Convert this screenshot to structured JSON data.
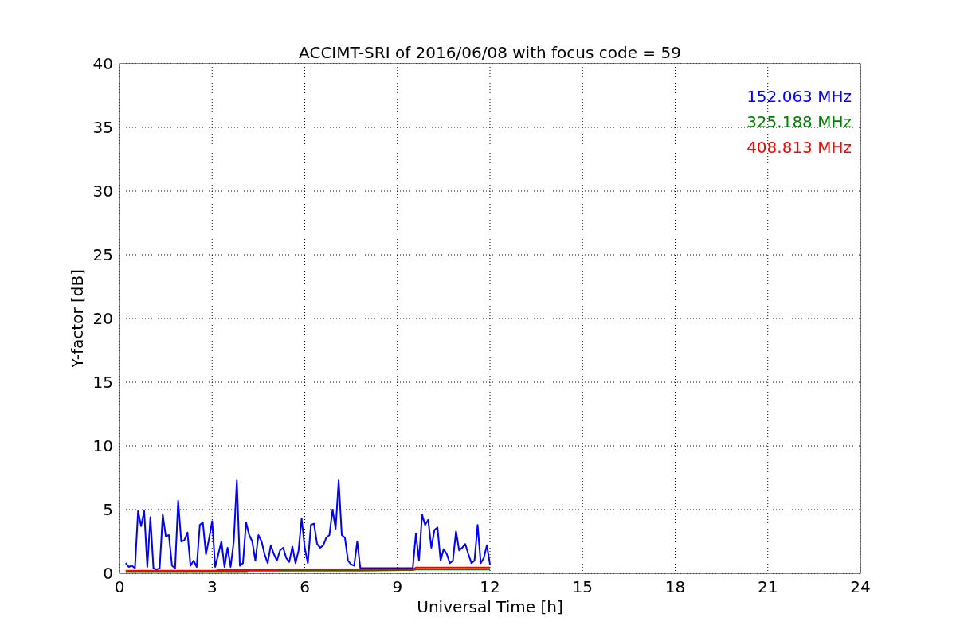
{
  "chart_data": {
    "type": "line",
    "title": "ACCIMT-SRI of 2016/06/08 with focus code = 59",
    "xlabel": "Universal Time [h]",
    "ylabel": "Y-factor [dB]",
    "x": [
      0.2,
      0.3,
      0.4,
      0.5,
      0.6,
      0.7,
      0.8,
      0.9,
      1.0,
      1.1,
      1.2,
      1.3,
      1.4,
      1.5,
      1.6,
      1.7,
      1.8,
      1.9,
      2.0,
      2.1,
      2.2,
      2.3,
      2.4,
      2.5,
      2.6,
      2.7,
      2.8,
      2.9,
      3.0,
      3.1,
      3.2,
      3.3,
      3.4,
      3.5,
      3.6,
      3.7,
      3.8,
      3.9,
      4.0,
      4.1,
      4.2,
      4.3,
      4.4,
      4.5,
      4.6,
      4.7,
      4.8,
      4.9,
      5.0,
      5.1,
      5.2,
      5.3,
      5.4,
      5.5,
      5.6,
      5.7,
      5.8,
      5.9,
      6.0,
      6.1,
      6.2,
      6.3,
      6.4,
      6.5,
      6.6,
      6.7,
      6.8,
      6.9,
      7.0,
      7.1,
      7.2,
      7.3,
      7.4,
      7.5,
      7.6,
      7.7,
      7.8,
      9.5,
      9.6,
      9.7,
      9.8,
      9.9,
      10.0,
      10.1,
      10.2,
      10.3,
      10.4,
      10.5,
      10.6,
      10.7,
      10.8,
      10.9,
      11.0,
      11.1,
      11.2,
      11.3,
      11.4,
      11.5,
      11.6,
      11.7,
      11.8,
      11.9,
      12.0
    ],
    "series": [
      {
        "name": "152.063 MHz",
        "color": "#0000ff",
        "values": [
          0.8,
          0.5,
          0.6,
          0.4,
          4.9,
          3.7,
          4.9,
          0.5,
          4.4,
          0.4,
          0.3,
          0.4,
          4.6,
          2.9,
          3.0,
          0.6,
          0.4,
          5.7,
          2.5,
          2.6,
          3.2,
          0.6,
          1.0,
          0.5,
          3.8,
          4.0,
          1.5,
          2.7,
          4.1,
          0.5,
          1.5,
          2.5,
          0.5,
          2.0,
          0.5,
          2.5,
          7.3,
          0.6,
          0.8,
          4.0,
          3.0,
          2.5,
          1.0,
          3.0,
          2.5,
          1.5,
          0.8,
          2.2,
          1.5,
          1.0,
          1.8,
          2.0,
          1.2,
          0.9,
          2.1,
          0.8,
          1.8,
          4.3,
          2.0,
          0.8,
          3.8,
          3.9,
          2.3,
          2.0,
          2.2,
          2.8,
          3.0,
          5.0,
          3.5,
          7.3,
          3.0,
          2.8,
          1.0,
          0.7,
          0.6,
          2.5,
          0.4,
          0.4,
          3.1,
          1.0,
          4.6,
          3.8,
          4.2,
          2.0,
          3.4,
          3.6,
          1.0,
          1.9,
          1.5,
          0.8,
          1.0,
          3.3,
          1.8,
          2.0,
          2.3,
          1.5,
          0.8,
          1.0,
          3.8,
          0.8,
          1.2,
          2.2,
          0.7
        ]
      },
      {
        "name": "325.188 MHz",
        "color": "#008000",
        "values": [
          0.15,
          0.15,
          0.15,
          0.15,
          0.15,
          0.15,
          0.15,
          0.15,
          0.15,
          0.15,
          0.15,
          0.15,
          0.15,
          0.15,
          0.15,
          0.15,
          0.15,
          0.15,
          0.15,
          0.15,
          0.15,
          0.15,
          0.15,
          0.15,
          0.15,
          0.15,
          0.15,
          0.15,
          0.15,
          0.15,
          0.15,
          0.15,
          0.15,
          0.15,
          0.15,
          0.15,
          0.15,
          0.15,
          0.15,
          0.15,
          0.2,
          0.2,
          0.2,
          0.2,
          0.2,
          0.2,
          0.2,
          0.2,
          0.2,
          0.2,
          0.2,
          0.2,
          0.2,
          0.2,
          0.2,
          0.2,
          0.2,
          0.2,
          0.2,
          0.2,
          0.2,
          0.2,
          0.2,
          0.2,
          0.2,
          0.2,
          0.2,
          0.2,
          0.2,
          0.2,
          0.2,
          0.2,
          0.2,
          0.2,
          0.2,
          0.2,
          0.2,
          0.25,
          0.3,
          0.3,
          0.3,
          0.3,
          0.3,
          0.3,
          0.3,
          0.3,
          0.3,
          0.3,
          0.3,
          0.3,
          0.3,
          0.3,
          0.3,
          0.3,
          0.3,
          0.3,
          0.3,
          0.3,
          0.3,
          0.3,
          0.3,
          0.3,
          0.3
        ]
      },
      {
        "name": "408.813 MHz",
        "color": "#ff0000",
        "values": [
          0.2,
          0.2,
          0.2,
          0.2,
          0.2,
          0.2,
          0.2,
          0.2,
          0.2,
          0.2,
          0.2,
          0.2,
          0.2,
          0.2,
          0.2,
          0.2,
          0.2,
          0.2,
          0.2,
          0.2,
          0.2,
          0.2,
          0.2,
          0.2,
          0.2,
          0.2,
          0.2,
          0.2,
          0.2,
          0.2,
          0.25,
          0.25,
          0.25,
          0.25,
          0.25,
          0.25,
          0.25,
          0.25,
          0.25,
          0.25,
          0.25,
          0.25,
          0.25,
          0.25,
          0.25,
          0.25,
          0.25,
          0.25,
          0.25,
          0.25,
          0.3,
          0.3,
          0.3,
          0.3,
          0.3,
          0.3,
          0.3,
          0.3,
          0.3,
          0.3,
          0.3,
          0.3,
          0.3,
          0.3,
          0.3,
          0.3,
          0.3,
          0.3,
          0.3,
          0.3,
          0.3,
          0.3,
          0.3,
          0.3,
          0.3,
          0.3,
          0.3,
          0.3,
          0.45,
          0.45,
          0.45,
          0.45,
          0.45,
          0.45,
          0.45,
          0.45,
          0.45,
          0.45,
          0.45,
          0.45,
          0.45,
          0.45,
          0.45,
          0.45,
          0.45,
          0.45,
          0.45,
          0.45,
          0.45,
          0.45,
          0.45,
          0.45,
          0.45
        ]
      }
    ],
    "xlim": [
      0,
      24
    ],
    "ylim": [
      0,
      40
    ],
    "grid": true,
    "xticks": [
      0,
      3,
      6,
      9,
      12,
      15,
      18,
      21,
      24
    ],
    "yticks": [
      0,
      5,
      10,
      15,
      20,
      25,
      30,
      35,
      40
    ]
  }
}
